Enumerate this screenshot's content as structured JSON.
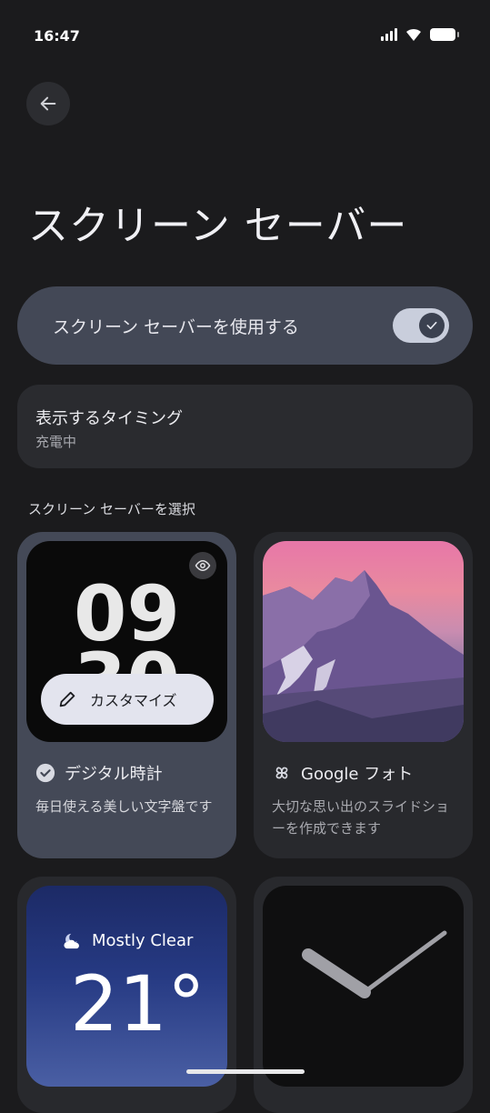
{
  "status": {
    "time": "16:47"
  },
  "header": {
    "title": "スクリーン セーバー"
  },
  "toggle": {
    "label": "スクリーン セーバーを使用する",
    "enabled": true
  },
  "timing": {
    "title": "表示するタイミング",
    "value": "充電中"
  },
  "section": {
    "label": "スクリーン セーバーを選択"
  },
  "cards": [
    {
      "name": "デジタル時計",
      "description": "毎日使える美しい文字盤です",
      "selected": true,
      "clock_top": "09",
      "clock_bottom": "30",
      "customize_label": "カスタマイズ"
    },
    {
      "name": "Google フォト",
      "description": "大切な思い出のスライドショーを作成できます",
      "selected": false
    },
    {
      "condition": "Mostly Clear",
      "temperature": "21°"
    },
    {}
  ],
  "colors": {
    "background": "#1b1b1d",
    "toggle_row": "#434856",
    "card": "#28292d",
    "selected_card": "#444957"
  },
  "icons": [
    "back-arrow-icon",
    "signal-icon",
    "wifi-icon",
    "battery-icon",
    "check-icon",
    "eye-icon",
    "pencil-icon",
    "pinwheel-icon",
    "cloud-moon-icon"
  ]
}
